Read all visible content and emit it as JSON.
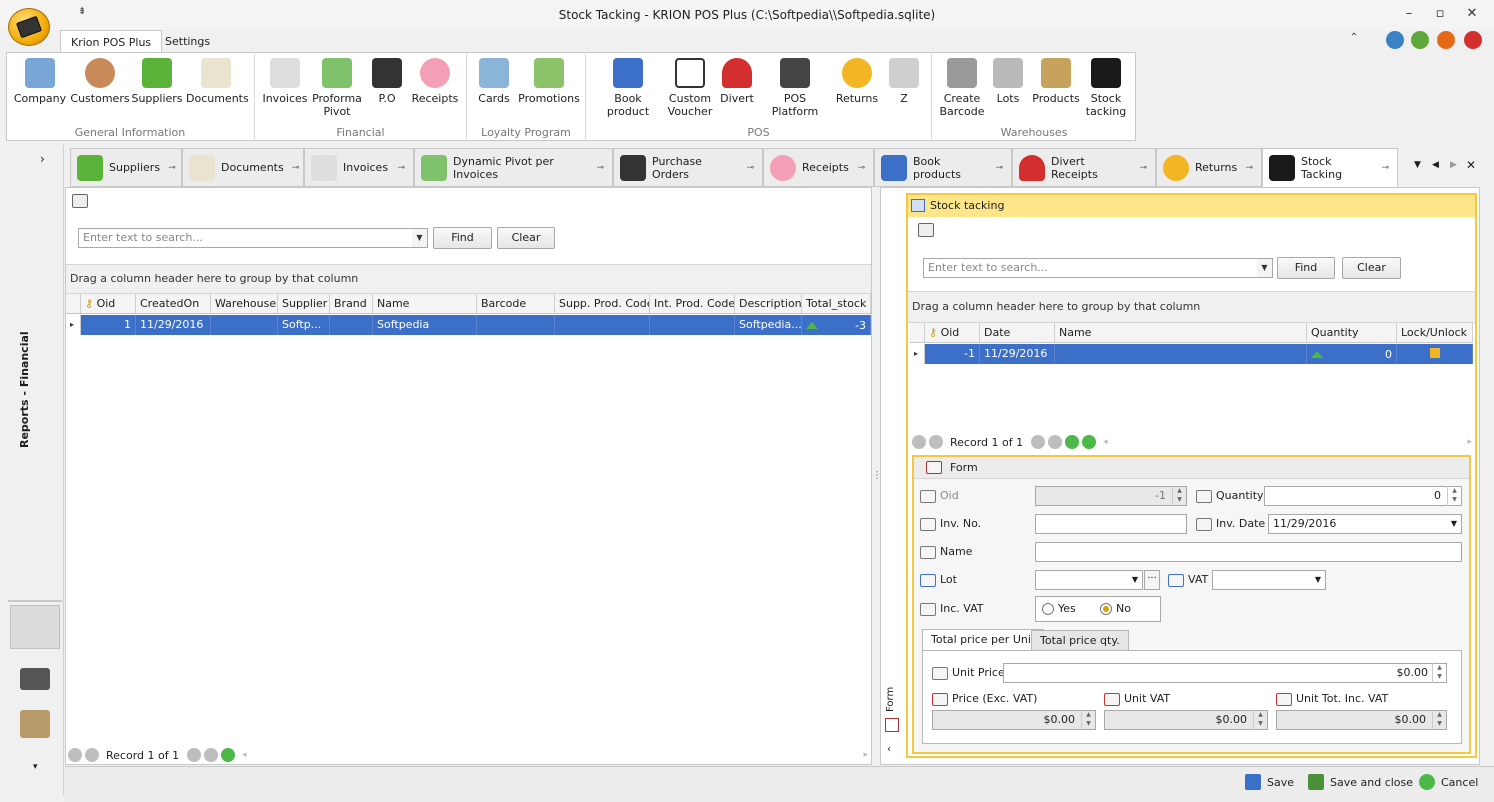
{
  "window": {
    "title": "Stock Tacking - KRION POS Plus (C:\\Softpedia\\\\Softpedia.sqlite)",
    "qat_label": "⇟"
  },
  "ribbon_tabs": [
    "Krion POS Plus",
    "Settings"
  ],
  "ribbon_groups": [
    {
      "label": "General Information",
      "buttons": [
        "Company",
        "Customers",
        "Suppliers",
        "Documents"
      ]
    },
    {
      "label": "Financial",
      "buttons": [
        "Invoices",
        "Proforma Pivot",
        "P.O",
        "Receipts"
      ]
    },
    {
      "label": "Loyalty Program",
      "buttons": [
        "Cards",
        "Promotions"
      ]
    },
    {
      "label": "POS",
      "buttons": [
        "Book product",
        "Custom Voucher",
        "Divert",
        "POS Platform",
        "Returns",
        "Z"
      ]
    },
    {
      "label": "Warehouses",
      "buttons": [
        "Create Barcode",
        "Lots",
        "Products",
        "Stock tacking"
      ]
    }
  ],
  "left_strip": {
    "label": "Reports - Financial"
  },
  "doc_tabs": [
    "Suppliers",
    "Documents",
    "Invoices",
    "Dynamic Pivot per Invoices",
    "Purchase Orders",
    "Receipts",
    "Book products",
    "Divert Receipts",
    "Returns",
    "Stock Tacking"
  ],
  "doc_tab_controls": [
    "▼",
    "◀",
    "▶",
    "✕"
  ],
  "left_panel": {
    "search_placeholder": "Enter text to search...",
    "find": "Find",
    "clear": "Clear",
    "group_hint": "Drag a column header here to group by that column",
    "columns": [
      "Oid",
      "CreatedOn",
      "Warehouse",
      "Supplier",
      "Brand",
      "Name",
      "Barcode",
      "Supp. Prod. Code",
      "Int. Prod. Code",
      "Description",
      "Total_stock"
    ],
    "row": [
      "1",
      "11/29/2016",
      "",
      "Softp...",
      "",
      "Softpedia",
      "",
      "",
      "",
      "Softpedia...",
      "-3"
    ],
    "record_text": "Record 1 of 1"
  },
  "right_panel": {
    "title": "Stock tacking",
    "search_placeholder": "Enter text to search...",
    "find": "Find",
    "clear": "Clear",
    "group_hint": "Drag a column header here to group by that column",
    "columns": [
      "Oid",
      "Date",
      "Name",
      "Quantity",
      "Lock/Unlock"
    ],
    "row": [
      "-1",
      "11/29/2016",
      "",
      "0",
      ""
    ],
    "record_text": "Record 1 of 1",
    "side_label": "Form"
  },
  "form": {
    "title": "Form",
    "oid_label": "Oid",
    "oid_value": "-1",
    "quantity_label": "Quantity",
    "quantity_value": "0",
    "invno_label": "Inv. No.",
    "invdate_label": "Inv. Date",
    "invdate_value": "11/29/2016",
    "name_label": "Name",
    "lot_label": "Lot",
    "vat_label": "VAT",
    "incvat_label": "Inc. VAT",
    "yes": "Yes",
    "no": "No",
    "tab1": "Total price per Unit",
    "tab2": "Total price qty.",
    "unit_price_label": "Unit Price",
    "unit_price": "$0.00",
    "price_exc_label": "Price (Exc. VAT)",
    "price_exc": "$0.00",
    "unit_vat_label": "Unit VAT",
    "unit_vat": "$0.00",
    "unit_tot_label": "Unit Tot. Inc. VAT",
    "unit_tot": "$0.00"
  },
  "status": {
    "save": "Save",
    "save_close": "Save and close",
    "cancel": "Cancel"
  },
  "colors": {
    "selection": "#3c6fc7",
    "accent_yellow": "#f5c842",
    "up_arrow": "#4cb848"
  }
}
